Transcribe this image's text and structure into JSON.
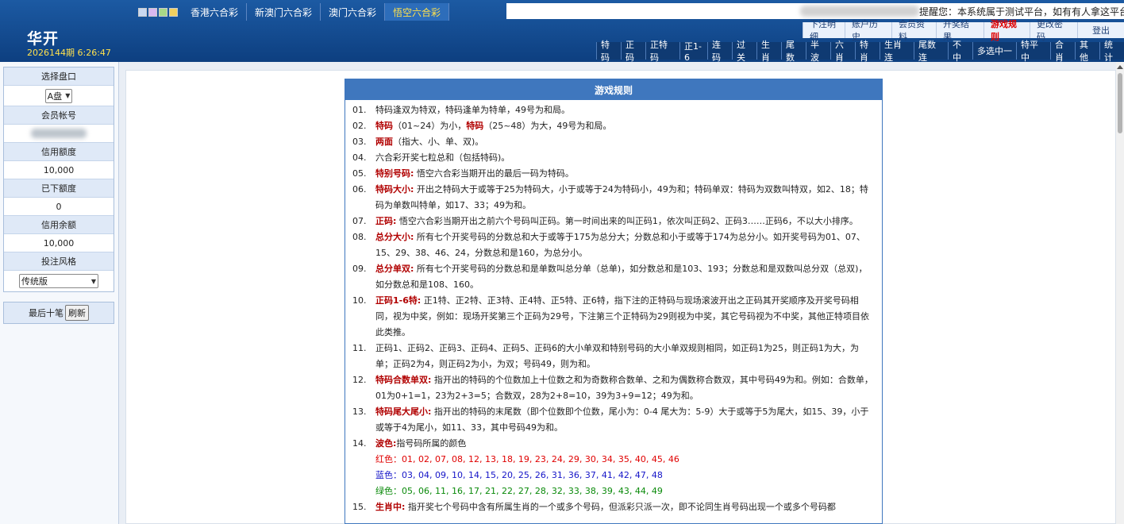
{
  "header": {
    "tabs": [
      {
        "label": "香港六合彩",
        "active": false
      },
      {
        "label": "新澳门六合彩",
        "active": false
      },
      {
        "label": "澳门六合彩",
        "active": false
      },
      {
        "label": "悟空六合彩",
        "active": true
      }
    ],
    "notice": "提醒您：本系统属于测试平台，如有有人拿这平台作为",
    "brand": "华开",
    "issue": "2026144期 6:26:47",
    "user_menu": [
      "下注明细",
      "账户历史",
      "会员资料",
      "开奖结果",
      "游戏规则",
      "更改密码",
      "登出"
    ],
    "user_menu_active": "游戏规则",
    "play_menu": [
      "特码",
      "正码",
      "正特码",
      "正1-6",
      "连码",
      "过关",
      "生肖",
      "尾数",
      "半波",
      "六肖",
      "特肖",
      "生肖连",
      "尾数连",
      "不中",
      "多选中一",
      "特平中",
      "合肖",
      "其他",
      "统计"
    ]
  },
  "sidebar": {
    "select_pan_label": "选择盘口",
    "select_pan_value": "A盘",
    "member_account_label": "会员帐号",
    "credit_label": "信用额度",
    "credit_value": "10,000",
    "placed_label": "已下额度",
    "placed_value": "0",
    "balance_label": "信用余额",
    "balance_value": "10,000",
    "style_label": "投注风格",
    "style_value": "传统版",
    "last_ten_label": "最后十笔",
    "refresh_label": "刷新"
  },
  "rules": {
    "title": "游戏规则",
    "items": [
      {
        "num": "01.",
        "key": "",
        "text": "特码逢双为特双，特码逢单为特单，49号为和局。"
      },
      {
        "num": "02.",
        "key": "",
        "text": ""
      },
      {
        "num": "03.",
        "key": "两面",
        "text": "（指大、小、单、双)。"
      },
      {
        "num": "04.",
        "key": "",
        "text": "六合彩开奖七粒总和（包括特码)。"
      },
      {
        "num": "05.",
        "key": "特别号码:",
        "text": " 悟空六合彩当期开出的最后一码为特码。"
      },
      {
        "num": "06.",
        "key": "特码大小:",
        "text": " 开出之特码大于或等于25为特码大，小于或等于24为特码小，49为和；特码单双：特码为双数叫特双，如2、18；特码为单数叫特单，如17、33；49为和。"
      },
      {
        "num": "07.",
        "key": "正码:",
        "text": " 悟空六合彩当期开出之前六个号码叫正码。第一时间出来的叫正码1，依次叫正码2、正码3……正码6，不以大小排序。"
      },
      {
        "num": "08.",
        "key": "总分大小:",
        "text": " 所有七个开奖号码的分数总和大于或等于175为总分大；分数总和小于或等于174为总分小。如开奖号码为01、07、15、29、38、46、24，分数总和是160，为总分小。"
      },
      {
        "num": "09.",
        "key": "总分单双:",
        "text": " 所有七个开奖号码的分数总和是单数叫总分单（总单)，如分数总和是103、193；分数总和是双数叫总分双（总双)，如分数总和是108、160。"
      },
      {
        "num": "10.",
        "key": "正码1-6特:",
        "text": " 正1特、正2特、正3特、正4特、正5特、正6特，指下注的正特码与现场滚波开出之正码其开奖顺序及开奖号码相同，视为中奖，例如：现场开奖第三个正码为29号，下注第三个正特码为29则视为中奖，其它号码视为不中奖，其他正特项目依此类推。"
      },
      {
        "num": "11.",
        "key": "",
        "text": "正码1、正码2、正码3、正码4、正码5、正码6的大小单双和特别号码的大小单双规则相同，如正码1为25，则正码1为大，为单；正码2为4，则正码2为小，为双；号码49，则为和。"
      },
      {
        "num": "12.",
        "key": "特码合数单双:",
        "text": " 指开出的特码的个位数加上十位数之和为奇数称合数单、之和为偶数称合数双，其中号码49为和。例如：合数单，01为0+1=1，23为2+3=5；合数双，28为2+8=10，39为3+9=12；49为和。"
      },
      {
        "num": "13.",
        "key": "特码尾大尾小:",
        "text": " 指开出的特码的末尾数（即个位数即个位数，尾小为：0-4 尾大为：5-9）大于或等于5为尾大，如15、39，小于或等于4为尾小，如11、33，其中号码49为和。"
      },
      {
        "num": "14.",
        "key": "波色:",
        "text": "指号码所属的颜色"
      },
      {
        "num": "15.",
        "key": "生肖中:",
        "text": " 指开奖七个号码中含有所属生肖的一个或多个号码，但派彩只派一次，即不论同生肖号码出现一个或多个号码都"
      }
    ],
    "rule02": {
      "k1": "特码",
      "t1": "（01~24）为小，",
      "k2": "特码",
      "t2": "（25~48）为大，49号为和局。"
    },
    "wave_colors": {
      "red": "红色：01, 02, 07, 08, 12, 13, 18, 19, 23, 24, 29, 30, 34, 35, 40, 45, 46",
      "blue": "蓝色：03, 04, 09, 10, 14, 15, 20, 25, 26, 31, 36, 37, 41, 42, 47, 48",
      "green": "绿色：05, 06, 11, 16, 17, 21, 22, 27, 28, 32, 33, 38, 39, 43, 44, 49"
    }
  }
}
